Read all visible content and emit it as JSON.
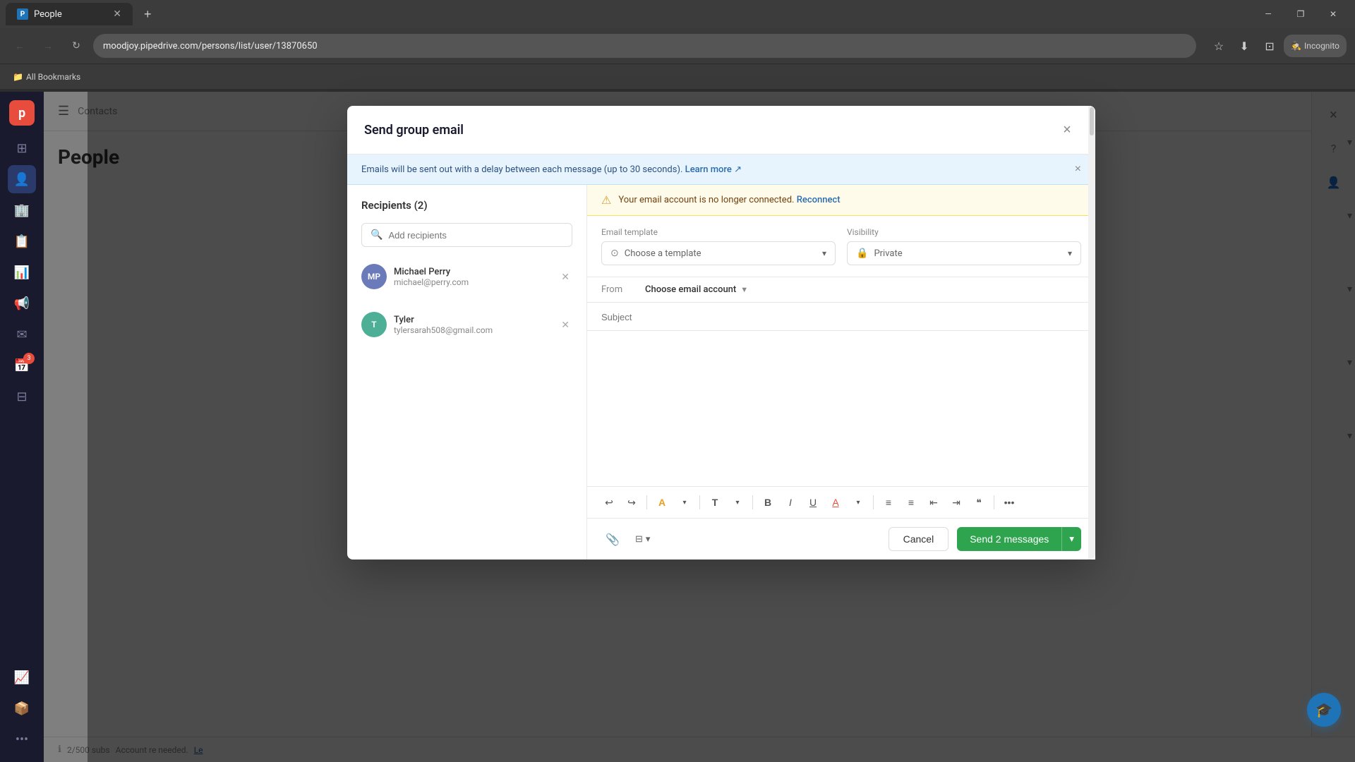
{
  "browser": {
    "tab_title": "People",
    "tab_favicon": "P",
    "url": "moodjoy.pipedrive.com/persons/list/user/13870650",
    "new_tab_label": "+",
    "incognito_label": "Incognito",
    "bookmarks_label": "All Bookmarks",
    "win_minimize": "—",
    "win_restore": "❐",
    "win_close": "✕"
  },
  "sidebar": {
    "logo": "p",
    "icons": [
      {
        "name": "home-icon",
        "symbol": "⊞",
        "active": false
      },
      {
        "name": "people-icon",
        "symbol": "👤",
        "active": true
      },
      {
        "name": "org-icon",
        "symbol": "🏢",
        "active": false
      },
      {
        "name": "contacts-icon",
        "symbol": "📋",
        "active": false
      },
      {
        "name": "activity-icon",
        "symbol": "📊",
        "active": false
      },
      {
        "name": "announcements-icon",
        "symbol": "📢",
        "active": false
      },
      {
        "name": "mail-icon",
        "symbol": "✉",
        "active": false
      },
      {
        "name": "calendar-icon",
        "symbol": "📅",
        "badge": "3",
        "active": false
      },
      {
        "name": "pipelines-icon",
        "symbol": "⊟",
        "active": false
      }
    ],
    "bottom_icons": [
      {
        "name": "reports-icon",
        "symbol": "📈"
      },
      {
        "name": "products-icon",
        "symbol": "📦"
      },
      {
        "name": "more-icon",
        "symbol": "•••"
      }
    ]
  },
  "page": {
    "nav_hamburger": "☰",
    "breadcrumb": "Contacts",
    "title": "People"
  },
  "modal": {
    "title": "Send group email",
    "close_label": "×",
    "info_banner": {
      "text": "Emails will be sent out with a delay between each message (up to 30 seconds).",
      "link_text": "Learn more ↗",
      "close": "×"
    },
    "warning_banner": {
      "text": "Your email account is no longer connected.",
      "link_text": "Reconnect"
    },
    "recipients": {
      "title": "Recipients (2)",
      "search_placeholder": "Add recipients",
      "items": [
        {
          "initials": "MP",
          "name": "Michael Perry",
          "email": "michael@perry.com",
          "color": "#6b7ab8"
        },
        {
          "initials": "T",
          "name": "Tyler",
          "email": "tylersarah508@gmail.com",
          "color": "#4caf96"
        }
      ]
    },
    "email_template": {
      "label": "Email template",
      "placeholder": "Choose a template",
      "icon": "⊙"
    },
    "visibility": {
      "label": "Visibility",
      "value": "Private",
      "icon": "🔒"
    },
    "from": {
      "label": "From",
      "placeholder": "Choose email account",
      "dropdown_icon": "▼"
    },
    "subject": {
      "placeholder": "Subject"
    },
    "toolbar": {
      "undo": "↩",
      "redo": "↪",
      "highlight": "A",
      "text_style": "T",
      "bold": "B",
      "italic": "I",
      "underline": "U",
      "font_color": "A",
      "ordered_list": "≡",
      "unordered_list": "≡",
      "indent_dec": "⇤",
      "indent_inc": "⇥",
      "quote": "❝",
      "more": "•••"
    },
    "footer": {
      "attach_icon": "📎",
      "format_icon": "⊟",
      "format_dropdown": "▾",
      "cancel_label": "Cancel",
      "send_label": "Send 2 messages",
      "send_dropdown": "▾"
    }
  },
  "status_bar": {
    "text": "2/500 subs",
    "subtext": "Account re needed. Le"
  },
  "right_panel": {
    "close_icon": "×"
  }
}
